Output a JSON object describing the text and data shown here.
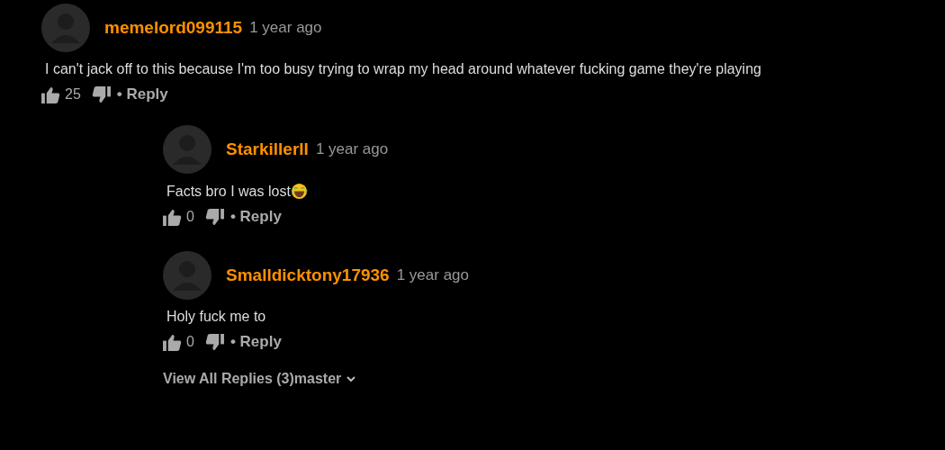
{
  "comment": {
    "username": "memelord099115",
    "time": "1 year ago",
    "text": "I can't jack off to this because I'm too busy trying to wrap my head around whatever fucking game they're playing",
    "likes": "25",
    "reply_label": "• Reply",
    "children": [
      {
        "username": "StarkillerII",
        "time": "1 year ago",
        "text": "Facts bro I was lost",
        "emoji": true,
        "likes": "0",
        "reply_label": "• Reply"
      },
      {
        "username": "Smalldicktony17936",
        "time": "1 year ago",
        "text": "Holy fuck me to",
        "emoji": false,
        "likes": "0",
        "reply_label": "• Reply"
      }
    ]
  },
  "view_all_replies": "View All Replies (3)master"
}
